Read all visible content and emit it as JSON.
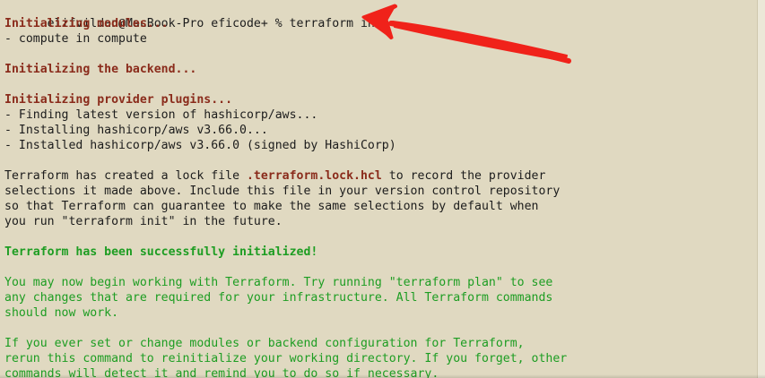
{
  "terminal": {
    "prompt": "elifvildan@MacBook-Pro eficode+ % terraform init",
    "lines": [
      {
        "text": "Initializing modules...",
        "style": "bold red"
      },
      {
        "text": "- compute in compute",
        "style": ""
      },
      {
        "text": "",
        "style": ""
      },
      {
        "text": "Initializing the backend...",
        "style": "bold red"
      },
      {
        "text": "",
        "style": ""
      },
      {
        "text": "Initializing provider plugins...",
        "style": "bold red"
      },
      {
        "text": "- Finding latest version of hashicorp/aws...",
        "style": ""
      },
      {
        "text": "- Installing hashicorp/aws v3.66.0...",
        "style": ""
      },
      {
        "text": "- Installed hashicorp/aws v3.66.0 (signed by HashiCorp)",
        "style": ""
      },
      {
        "text": "",
        "style": ""
      }
    ],
    "lock_paragraph": {
      "line1_before": "Terraform has created a lock file ",
      "lock_file": ".terraform.lock.hcl",
      "line1_after": " to record the provider",
      "line2": "selections it made above. Include this file in your version control repository",
      "line3": "so that Terraform can guarantee to make the same selections by default when",
      "line4": "you run \"terraform init\" in the future."
    },
    "success_message": "Terraform has been successfully initialized!",
    "next_steps": [
      "You may now begin working with Terraform. Try running \"terraform plan\" to see",
      "any changes that are required for your infrastructure. All Terraform commands",
      "should now work."
    ],
    "reinit_notice": [
      "If you ever set or change modules or backend configuration for Terraform,",
      "rerun this command to reinitialize your working directory. If you forget, other",
      "commands will detect it and remind you to do so if necessary."
    ]
  },
  "colors": {
    "background": "#e0d9c1",
    "text": "#1c1c1c",
    "heading_red": "#8a2b1b",
    "success_green": "#1d9d22",
    "annotation_arrow": "#f0221a"
  },
  "annotation": {
    "icon": "arrow-pointing-left-icon"
  }
}
